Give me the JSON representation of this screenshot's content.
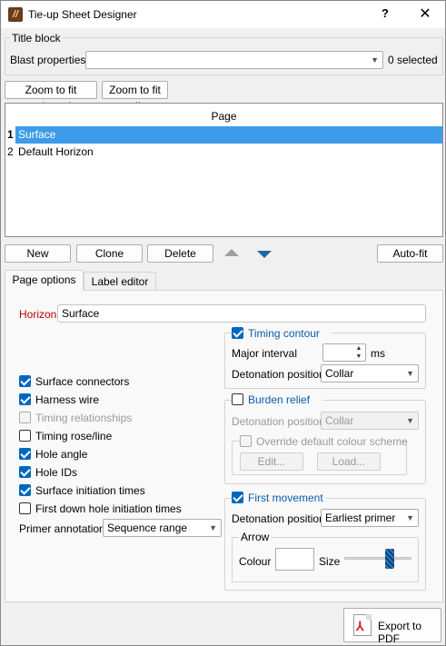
{
  "window": {
    "title": "Tie-up Sheet Designer",
    "help": "?",
    "close": "✕"
  },
  "title_block": {
    "label": "Title block",
    "blast_properties_label": "Blast properties",
    "blast_properties_value": "",
    "selected_count": "0 selected"
  },
  "zoom": {
    "fit_selected": "Zoom to fit selected",
    "fit_all": "Zoom to fit all"
  },
  "pages": {
    "header": "Page",
    "rows": [
      {
        "num": "1",
        "name": "Surface",
        "selected": true
      },
      {
        "num": "2",
        "name": "Default Horizon",
        "selected": false
      }
    ]
  },
  "page_buttons": {
    "new": "New",
    "clone": "Clone",
    "delete": "Delete",
    "auto_fit": "Auto-fit"
  },
  "tabs": [
    {
      "label": "Page options",
      "active": true
    },
    {
      "label": "Label editor",
      "active": false
    }
  ],
  "page_options": {
    "horizon_label": "Horizon",
    "horizon_value": "Surface",
    "checkboxes": [
      {
        "label": "Surface connectors",
        "checked": true,
        "enabled": true
      },
      {
        "label": "Harness wire",
        "checked": true,
        "enabled": true
      },
      {
        "label": "Timing relationships",
        "checked": false,
        "enabled": false
      },
      {
        "label": "Timing rose/line",
        "checked": false,
        "enabled": true
      },
      {
        "label": "Hole angle",
        "checked": true,
        "enabled": true
      },
      {
        "label": "Hole IDs",
        "checked": true,
        "enabled": true
      },
      {
        "label": "Surface initiation times",
        "checked": true,
        "enabled": true
      },
      {
        "label": "First down hole initiation times",
        "checked": false,
        "enabled": true
      }
    ],
    "primer_annotation_label": "Primer annotation",
    "primer_annotation_value": "Sequence range"
  },
  "timing_contour": {
    "label": "Timing contour",
    "checked": true,
    "major_interval_label": "Major interval",
    "major_interval_value": "",
    "major_interval_unit": "ms",
    "detonation_label": "Detonation position",
    "detonation_value": "Collar"
  },
  "burden_relief": {
    "label": "Burden relief",
    "checked": false,
    "detonation_label": "Detonation position",
    "detonation_value": "Collar",
    "override_label": "Override default colour scheme",
    "edit": "Edit...",
    "load": "Load..."
  },
  "first_movement": {
    "label": "First movement",
    "checked": true,
    "detonation_label": "Detonation position",
    "detonation_value": "Earliest primer",
    "arrow_label": "Arrow",
    "colour_label": "Colour",
    "size_label": "Size",
    "size_level": 0.74
  },
  "export": {
    "label": "Export to PDF"
  },
  "colors": {
    "selection": "#3d9be9",
    "checkbox": "#0067c0",
    "horizon_label": "#c00000",
    "pdf_red": "#d01f1f"
  }
}
